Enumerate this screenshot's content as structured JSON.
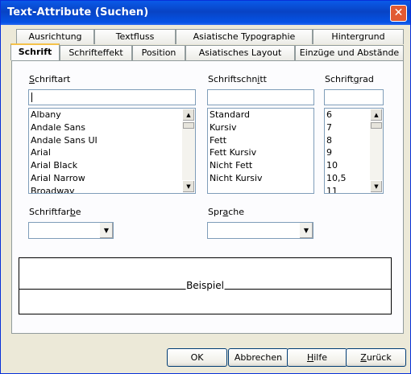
{
  "window": {
    "title": "Text-Attribute (Suchen)",
    "close_label": "✕"
  },
  "tabs_row1": [
    {
      "label": "Ausrichtung"
    },
    {
      "label": "Textfluss"
    },
    {
      "label": "Asiatische Typographie"
    },
    {
      "label": "Hintergrund"
    }
  ],
  "tabs_row2": [
    {
      "label": "Schrift",
      "active": true
    },
    {
      "label": "Schrifteffekt"
    },
    {
      "label": "Position"
    },
    {
      "label": "Asiatisches Layout"
    },
    {
      "label": "Einzüge und Abstände"
    }
  ],
  "font": {
    "label_prefix": "S",
    "label_rest": "chriftart",
    "value": "",
    "items": [
      "Albany",
      "Andale Sans",
      "Andale Sans UI",
      "Arial",
      "Arial Black",
      "Arial Narrow",
      "Broadway"
    ]
  },
  "style": {
    "label_prefix": "Schriftschn",
    "label_u": "i",
    "label_rest": "tt",
    "value": "",
    "items": [
      "Standard",
      "Kursiv",
      "Fett",
      "Fett Kursiv",
      "Nicht Fett",
      "Nicht Kursiv"
    ]
  },
  "size": {
    "label_prefix": "Schrift",
    "label_u": "g",
    "label_rest": "rad",
    "value": "",
    "items": [
      "6",
      "7",
      "8",
      "9",
      "10",
      "10,5",
      "11"
    ]
  },
  "font_color": {
    "label_prefix": "Schriftfar",
    "label_u": "b",
    "label_rest": "e",
    "value": ""
  },
  "language": {
    "label_prefix": "Spr",
    "label_u": "a",
    "label_rest": "che",
    "value": ""
  },
  "preview": {
    "sample_text": "Beispiel"
  },
  "buttons": {
    "ok": "OK",
    "cancel": "Abbrechen",
    "help_u": "H",
    "help_rest": "ilfe",
    "back_u": "Z",
    "back_rest": "urück"
  },
  "icons": {
    "scroll_up": "▲",
    "scroll_down": "▼",
    "dropdown": "▼"
  }
}
